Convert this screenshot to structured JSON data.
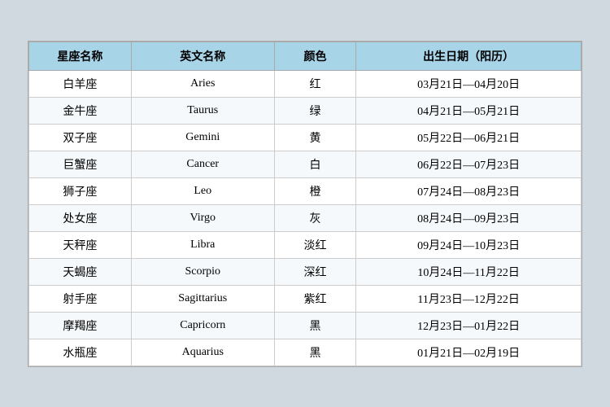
{
  "table": {
    "headers": [
      "星座名称",
      "英文名称",
      "颜色",
      "出生日期（阳历）"
    ],
    "rows": [
      {
        "cn": "白羊座",
        "en": "Aries",
        "color": "红",
        "date": "03月21日—04月20日"
      },
      {
        "cn": "金牛座",
        "en": "Taurus",
        "color": "绿",
        "date": "04月21日—05月21日"
      },
      {
        "cn": "双子座",
        "en": "Gemini",
        "color": "黄",
        "date": "05月22日—06月21日"
      },
      {
        "cn": "巨蟹座",
        "en": "Cancer",
        "color": "白",
        "date": "06月22日—07月23日"
      },
      {
        "cn": "狮子座",
        "en": "Leo",
        "color": "橙",
        "date": "07月24日—08月23日"
      },
      {
        "cn": "处女座",
        "en": "Virgo",
        "color": "灰",
        "date": "08月24日—09月23日"
      },
      {
        "cn": "天秤座",
        "en": "Libra",
        "color": "淡红",
        "date": "09月24日—10月23日"
      },
      {
        "cn": "天蝎座",
        "en": "Scorpio",
        "color": "深红",
        "date": "10月24日—11月22日"
      },
      {
        "cn": "射手座",
        "en": "Sagittarius",
        "color": "紫红",
        "date": "11月23日—12月22日"
      },
      {
        "cn": "摩羯座",
        "en": "Capricorn",
        "color": "黑",
        "date": "12月23日—01月22日"
      },
      {
        "cn": "水瓶座",
        "en": "Aquarius",
        "color": "黑",
        "date": "01月21日—02月19日"
      }
    ]
  }
}
